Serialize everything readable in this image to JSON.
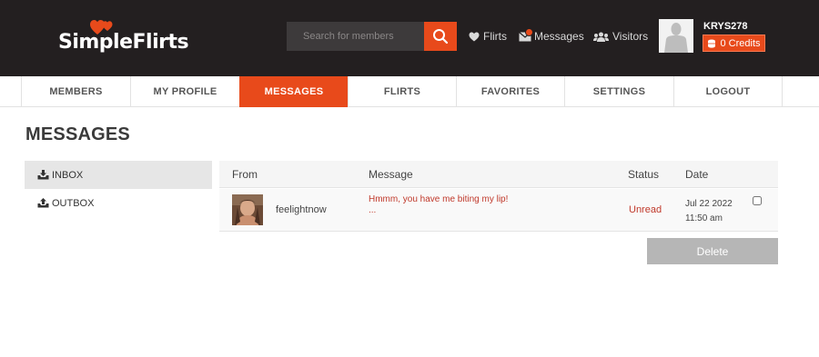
{
  "header": {
    "logo_text": "SimpleFlirts",
    "search": {
      "placeholder": "Search for members",
      "value": ""
    },
    "nav": {
      "flirts": "Flirts",
      "messages": "Messages",
      "visitors": "Visitors"
    },
    "user": {
      "username": "KRYS278",
      "credits": "0 Credits"
    }
  },
  "navbar": {
    "items": [
      {
        "label": "MEMBERS"
      },
      {
        "label": "MY PROFILE"
      },
      {
        "label": "MESSAGES",
        "active": true
      },
      {
        "label": "FLIRTS"
      },
      {
        "label": "FAVORITES"
      },
      {
        "label": "SETTINGS"
      },
      {
        "label": "LOGOUT"
      }
    ]
  },
  "page": {
    "title": "MESSAGES",
    "sidebar": {
      "inbox": "INBOX",
      "outbox": "OUTBOX"
    },
    "table": {
      "columns": {
        "from": "From",
        "message": "Message",
        "status": "Status",
        "date": "Date"
      },
      "rows": [
        {
          "sender": "feelightnow",
          "message": "Hmmm, you have me biting my lip!",
          "ellipsis": "...",
          "status": "Unread",
          "date": "Jul 22 2022",
          "time": "11:50 am"
        }
      ]
    },
    "delete_label": "Delete"
  },
  "colors": {
    "accent": "#e84a1b",
    "header_bg": "#231f20",
    "status_unread": "#c0392b"
  },
  "icons": [
    "search-icon",
    "heart-icon",
    "envelope-icon",
    "users-icon",
    "coins-icon",
    "inbox-icon",
    "outbox-icon"
  ]
}
